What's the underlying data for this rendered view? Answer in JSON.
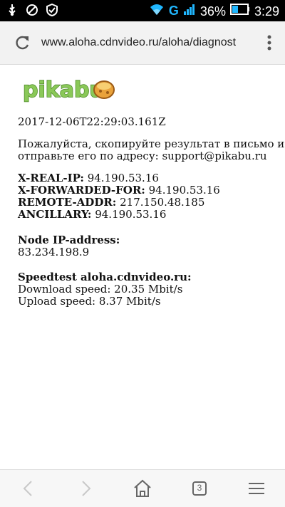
{
  "status_bar": {
    "battery_percent": "36%",
    "network": "G",
    "time": "3:29"
  },
  "browser": {
    "url": "www.aloha.cdnvideo.ru/aloha/diagnost",
    "tabs_count": "3"
  },
  "page": {
    "logo_text": "pikabu",
    "timestamp": "2017-12-06T22:29:03.161Z",
    "instruction_line1": "Пожалуйста, скопируйте результат в письмо и",
    "instruction_line2": "отправьте его по адресу: support@pikabu.ru",
    "ip_rows": [
      {
        "label": "X-REAL-IP:",
        "value": "94.190.53.16"
      },
      {
        "label": "X-FORWARDED-FOR:",
        "value": "94.190.53.16"
      },
      {
        "label": "REMOTE-ADDR:",
        "value": "217.150.48.185"
      },
      {
        "label": "ANCILLARY:",
        "value": "94.190.53.16"
      }
    ],
    "node_title": "Node IP-address:",
    "node_ip": "83.234.198.9",
    "speedtest_title": "Speedtest aloha.cdnvideo.ru:",
    "download": "Download speed: 20.35 Mbit/s",
    "upload": "Upload speed: 8.37 Mbit/s"
  }
}
